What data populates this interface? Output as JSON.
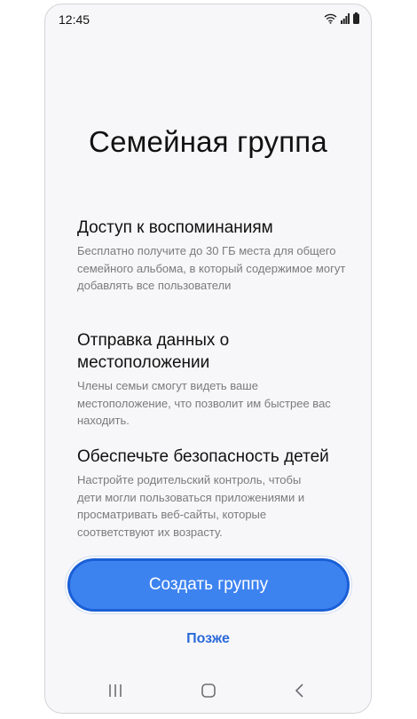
{
  "status": {
    "time": "12:45",
    "icons": [
      "wifi-icon",
      "signal-icon",
      "battery-icon"
    ]
  },
  "page": {
    "title": "Семейная группа"
  },
  "sections": [
    {
      "heading": "Доступ к воспоминаниям",
      "text": "Бесплатно получите до 30 ГБ места для общего семейного альбома, в который содержимое могут добавлять все пользователи"
    },
    {
      "heading": "Отправка данных о местоположении",
      "text": "Члены семьи смогут видеть ваше местоположение, что позволит им быстрее вас находить."
    },
    {
      "heading": "Обеспечьте безопасность детей",
      "text": "Настройте родительский контроль, чтобы дети могли пользоваться приложениями и просматривать веб-сайты, которые соответствуют их возрасту."
    }
  ],
  "actions": {
    "create_label": "Создать группу",
    "later_label": "Позже"
  },
  "nav": {
    "icons": [
      "recent-apps-icon",
      "home-icon",
      "back-icon"
    ]
  },
  "colors": {
    "accent": "#3d83f0",
    "accent_border": "#1a5fd6",
    "link": "#2b6ad9",
    "background": "#f7f7f9"
  }
}
